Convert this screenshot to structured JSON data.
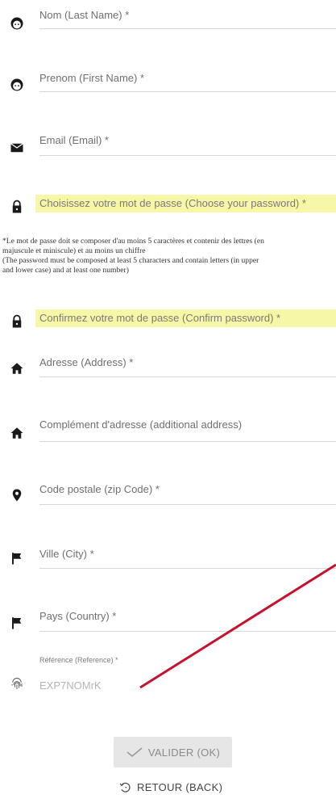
{
  "form": {
    "last_name_label": "Nom (Last Name) *",
    "first_name_label": "Prenom (First Name) *",
    "email_label": "Email (Email) *",
    "password_label": "Choisissez votre mot de passe (Choose your password) *",
    "password_note": [
      "*Le mot de passe doit se composer d'au moins 5 caractères et contenir des lettres (en",
      "majuscule et miniscule) et au moins un chiffre",
      "(The password must be composed at least 5 characters and contain letters (in upper",
      "and lower case) and at least one number)"
    ],
    "confirm_password_label": "Confirmez votre mot de passe (Confirm password) *",
    "address_label": "Adresse (Address) *",
    "additional_address_label": "Complément d'adresse (additional address)",
    "zip_label": "Code postale (zip Code) *",
    "city_label": "Ville (City) *",
    "country_label": "Pays (Country) *",
    "reference_label": "Référence (Reference) *",
    "reference_value": "EXP7NOMrK"
  },
  "actions": {
    "submit_label": "VALIDER (OK)",
    "back_label": "RETOUR (BACK)"
  },
  "colors": {
    "highlight": "#f7f7a8",
    "annotation_line": "#c8102e"
  },
  "icons": [
    "face-icon",
    "face-icon",
    "envelope-icon",
    "lock-icon",
    "lock-icon",
    "home-icon",
    "home-icon",
    "map-pin-icon",
    "flag-icon",
    "flag-icon",
    "fingerprint-icon",
    "check-icon",
    "undo-icon"
  ]
}
